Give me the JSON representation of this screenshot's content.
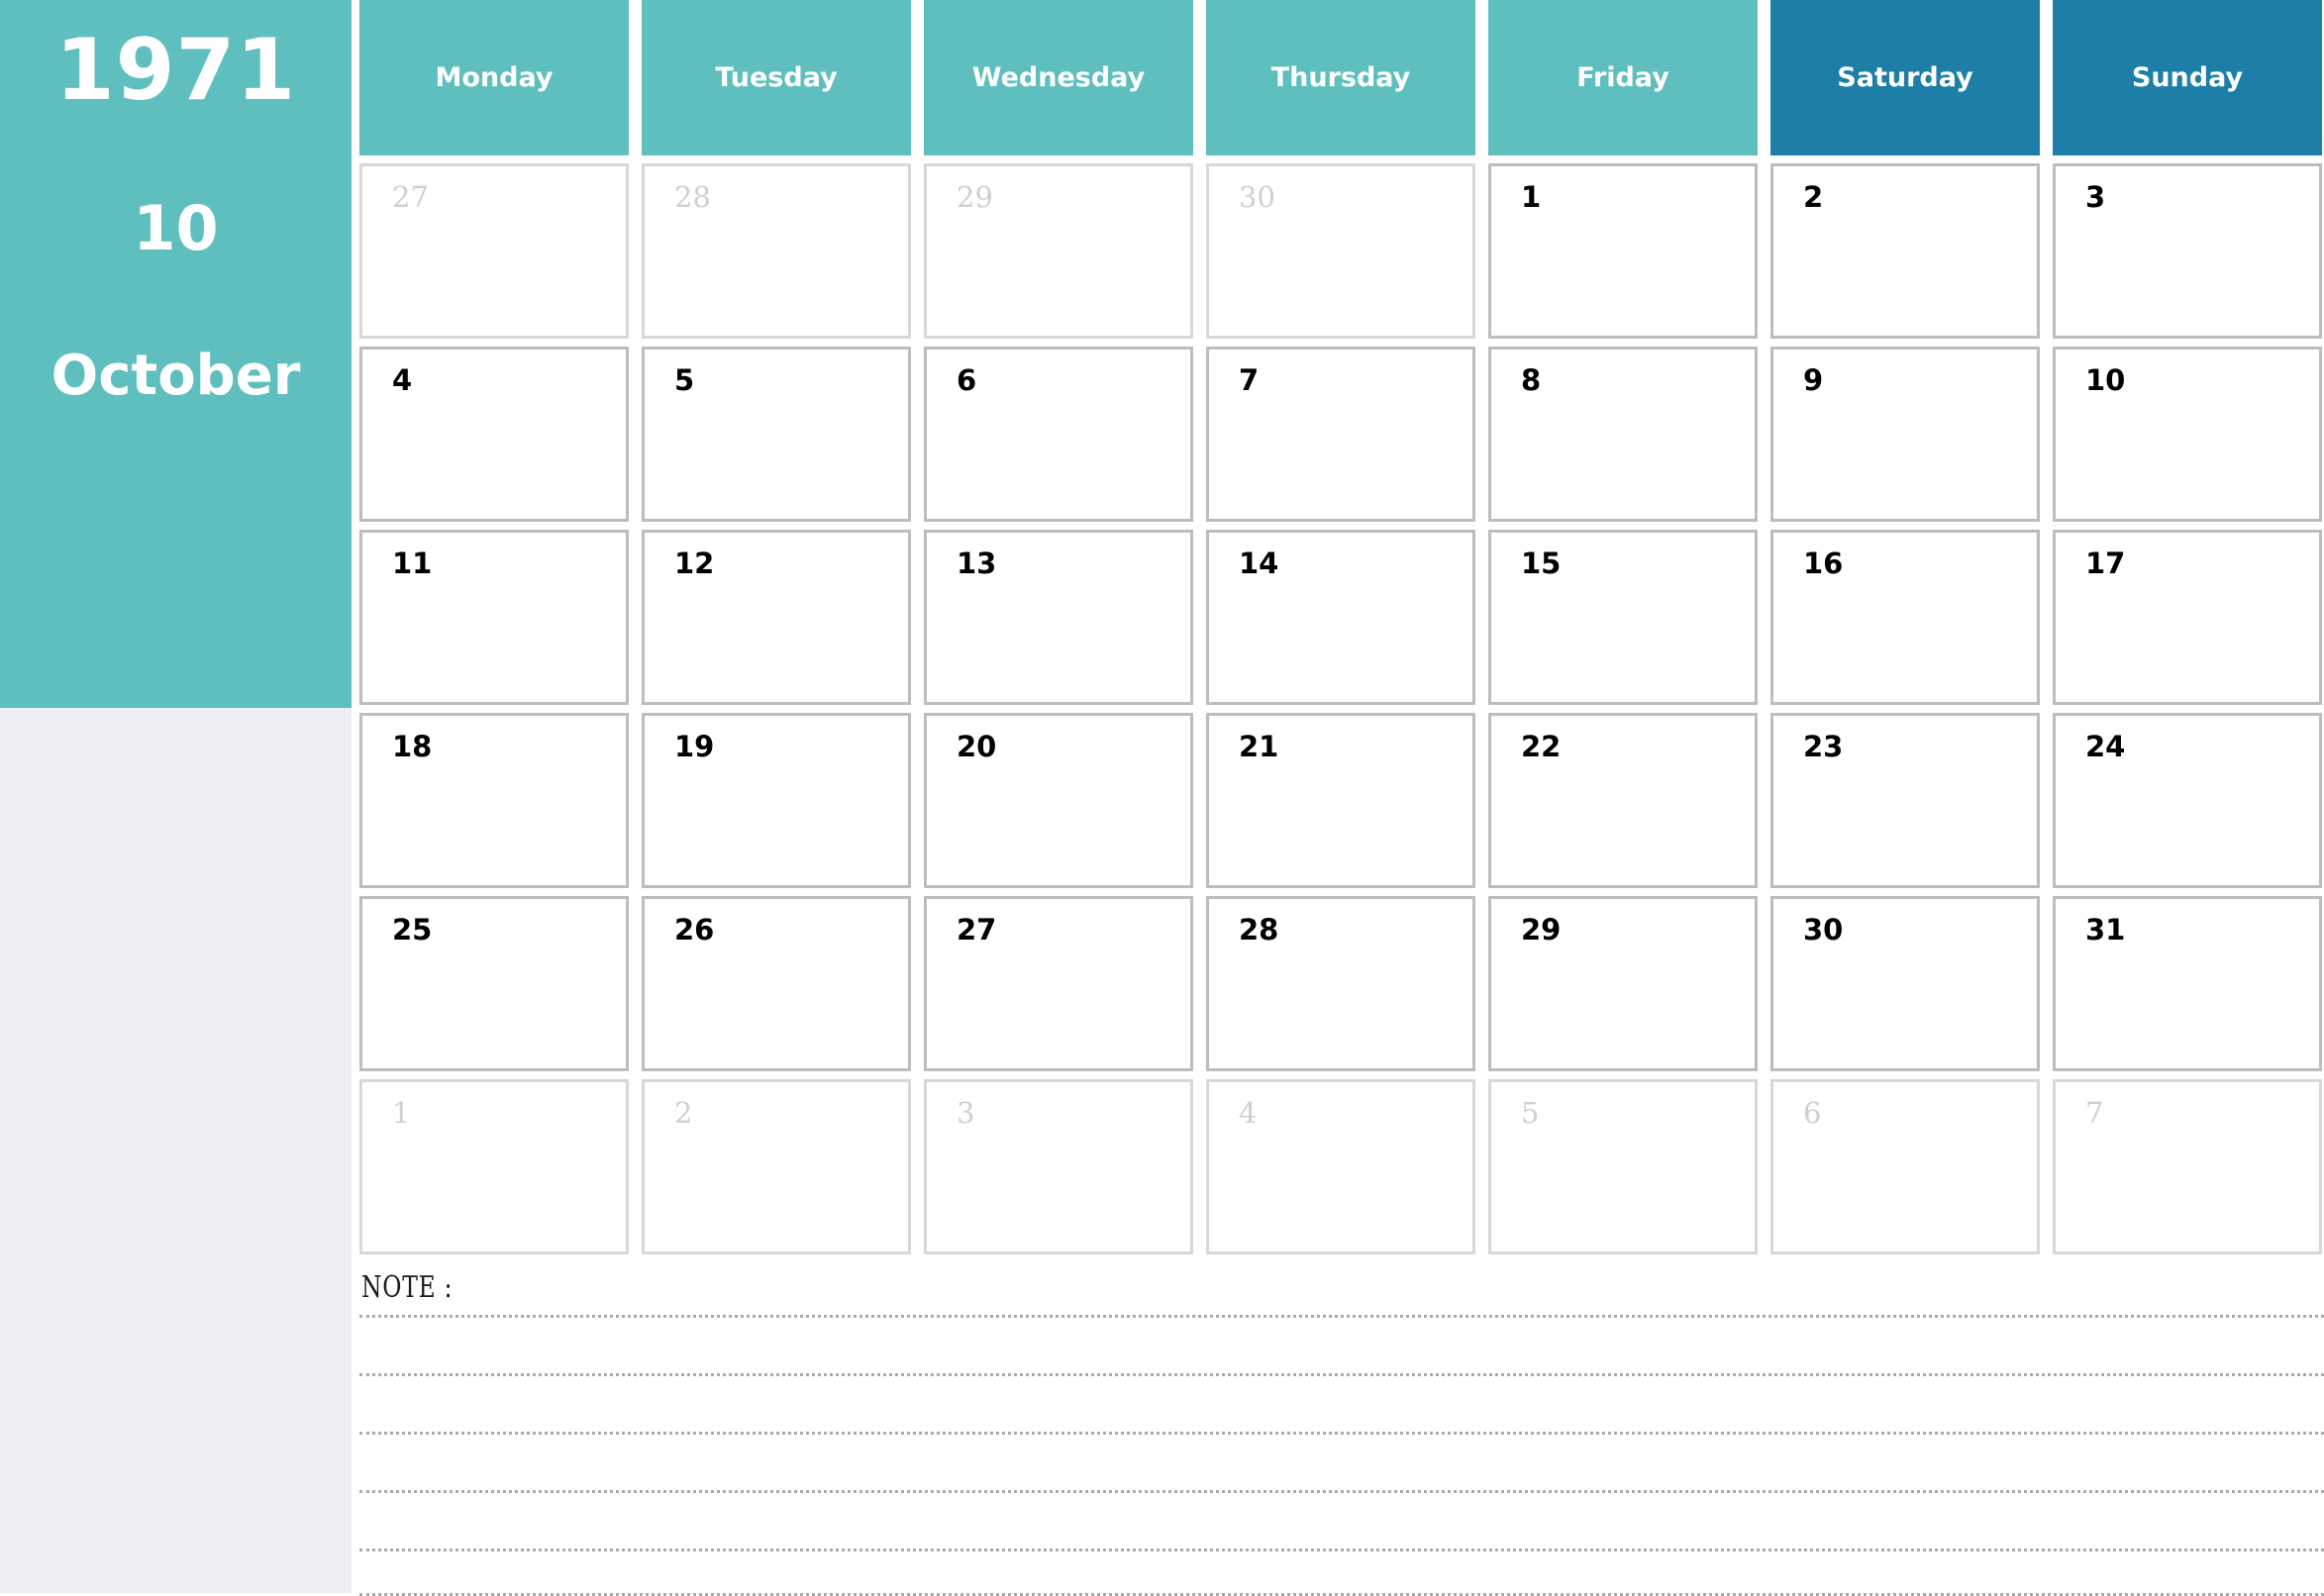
{
  "sidebar": {
    "year": "1971",
    "month_number": "10",
    "month_name": "October",
    "bg_color": "#5fbfbf",
    "lower_bg_color": "#efeef3"
  },
  "colors": {
    "weekday_header": "#5fbfbf",
    "weekend_header": "#1d7fa8",
    "cell_border": "#bdbdbd",
    "current_month_text": "#000000",
    "other_month_text": "#cfcfcf",
    "page_background": "#ffffff"
  },
  "weekday_headers": [
    {
      "label": "Monday",
      "weekend": false
    },
    {
      "label": "Tuesday",
      "weekend": false
    },
    {
      "label": "Wednesday",
      "weekend": false
    },
    {
      "label": "Thursday",
      "weekend": false
    },
    {
      "label": "Friday",
      "weekend": false
    },
    {
      "label": "Saturday",
      "weekend": true
    },
    {
      "label": "Sunday",
      "weekend": true
    }
  ],
  "weeks": [
    [
      {
        "day": "27",
        "current_month": false
      },
      {
        "day": "28",
        "current_month": false
      },
      {
        "day": "29",
        "current_month": false
      },
      {
        "day": "30",
        "current_month": false
      },
      {
        "day": "1",
        "current_month": true
      },
      {
        "day": "2",
        "current_month": true
      },
      {
        "day": "3",
        "current_month": true
      }
    ],
    [
      {
        "day": "4",
        "current_month": true
      },
      {
        "day": "5",
        "current_month": true
      },
      {
        "day": "6",
        "current_month": true
      },
      {
        "day": "7",
        "current_month": true
      },
      {
        "day": "8",
        "current_month": true
      },
      {
        "day": "9",
        "current_month": true
      },
      {
        "day": "10",
        "current_month": true
      }
    ],
    [
      {
        "day": "11",
        "current_month": true
      },
      {
        "day": "12",
        "current_month": true
      },
      {
        "day": "13",
        "current_month": true
      },
      {
        "day": "14",
        "current_month": true
      },
      {
        "day": "15",
        "current_month": true
      },
      {
        "day": "16",
        "current_month": true
      },
      {
        "day": "17",
        "current_month": true
      }
    ],
    [
      {
        "day": "18",
        "current_month": true
      },
      {
        "day": "19",
        "current_month": true
      },
      {
        "day": "20",
        "current_month": true
      },
      {
        "day": "21",
        "current_month": true
      },
      {
        "day": "22",
        "current_month": true
      },
      {
        "day": "23",
        "current_month": true
      },
      {
        "day": "24",
        "current_month": true
      }
    ],
    [
      {
        "day": "25",
        "current_month": true
      },
      {
        "day": "26",
        "current_month": true
      },
      {
        "day": "27",
        "current_month": true
      },
      {
        "day": "28",
        "current_month": true
      },
      {
        "day": "29",
        "current_month": true
      },
      {
        "day": "30",
        "current_month": true
      },
      {
        "day": "31",
        "current_month": true
      }
    ],
    [
      {
        "day": "1",
        "current_month": false
      },
      {
        "day": "2",
        "current_month": false
      },
      {
        "day": "3",
        "current_month": false
      },
      {
        "day": "4",
        "current_month": false
      },
      {
        "day": "5",
        "current_month": false
      },
      {
        "day": "6",
        "current_month": false
      },
      {
        "day": "7",
        "current_month": false
      }
    ]
  ],
  "note": {
    "label": "NOTE :",
    "line_count": 6,
    "line_tops": [
      45,
      104,
      163,
      222,
      281,
      326
    ]
  }
}
